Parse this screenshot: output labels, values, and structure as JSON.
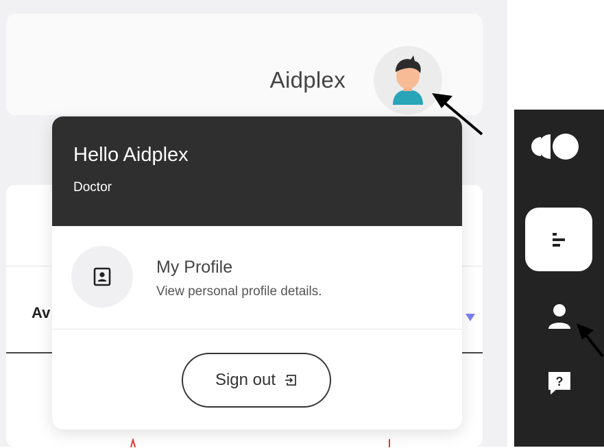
{
  "header": {
    "user_name": "Aidplex"
  },
  "dropdown": {
    "greeting": "Hello Aidplex",
    "role": "Doctor",
    "profile_item": {
      "title": "My Profile",
      "subtitle": "View personal profile details."
    },
    "signout_label": "Sign out"
  },
  "background": {
    "partial_heading": "Av"
  },
  "sidebar": {
    "help_icon_glyph": "?"
  },
  "colors": {
    "dropdown_header": "#2f2f30",
    "sidebar": "#232323",
    "accent_arrow": "#7b7ff0"
  }
}
